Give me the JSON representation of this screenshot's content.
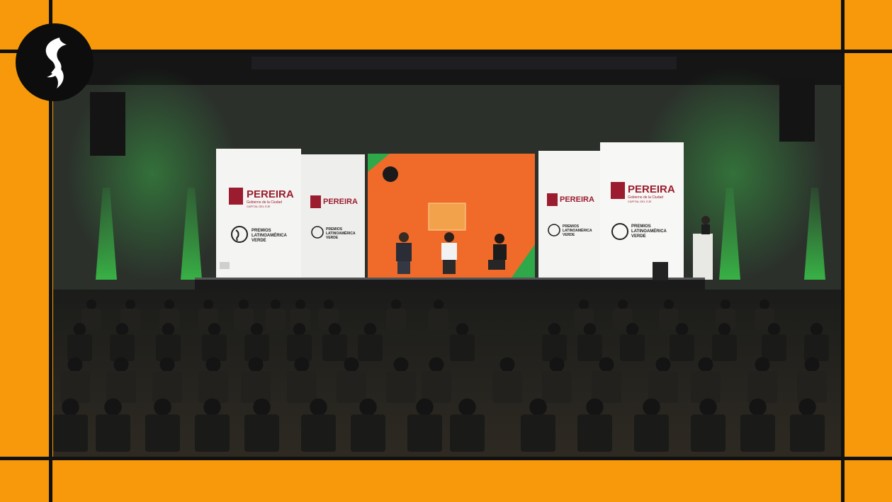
{
  "stream": {
    "frame_color": "#F7990A",
    "logo_icon": "flame-s-logo-icon"
  },
  "screens": {
    "left_outer": {
      "brand": "PEREIRA",
      "subtitle": "Gobierno de la Ciudad",
      "tagline": "CAPITAL DEL EJE",
      "award_line1": "PREMIOS",
      "award_line2": "LATINOAMÉRICA",
      "award_line3": "VERDE"
    },
    "left_inner": {
      "brand": "PEREIRA",
      "award_line1": "PREMIOS",
      "award_line2": "LATINOAMÉRICA",
      "award_line3": "VERDE"
    },
    "right_inner": {
      "brand": "PEREIRA",
      "award_line1": "PREMIOS",
      "award_line2": "LATINOAMÉRICA",
      "award_line3": "VERDE"
    },
    "right_outer": {
      "brand": "PEREIRA",
      "subtitle": "Gobierno de la Ciudad",
      "tagline": "CAPITAL DEL EJE",
      "award_line1": "PREMIOS",
      "award_line2": "LATINOAMÉRICA",
      "award_line3": "VERDE"
    },
    "center_color": "#F06A2A",
    "brand_color": "#9B1C2E",
    "stage_light_color": "#2FB84A"
  }
}
